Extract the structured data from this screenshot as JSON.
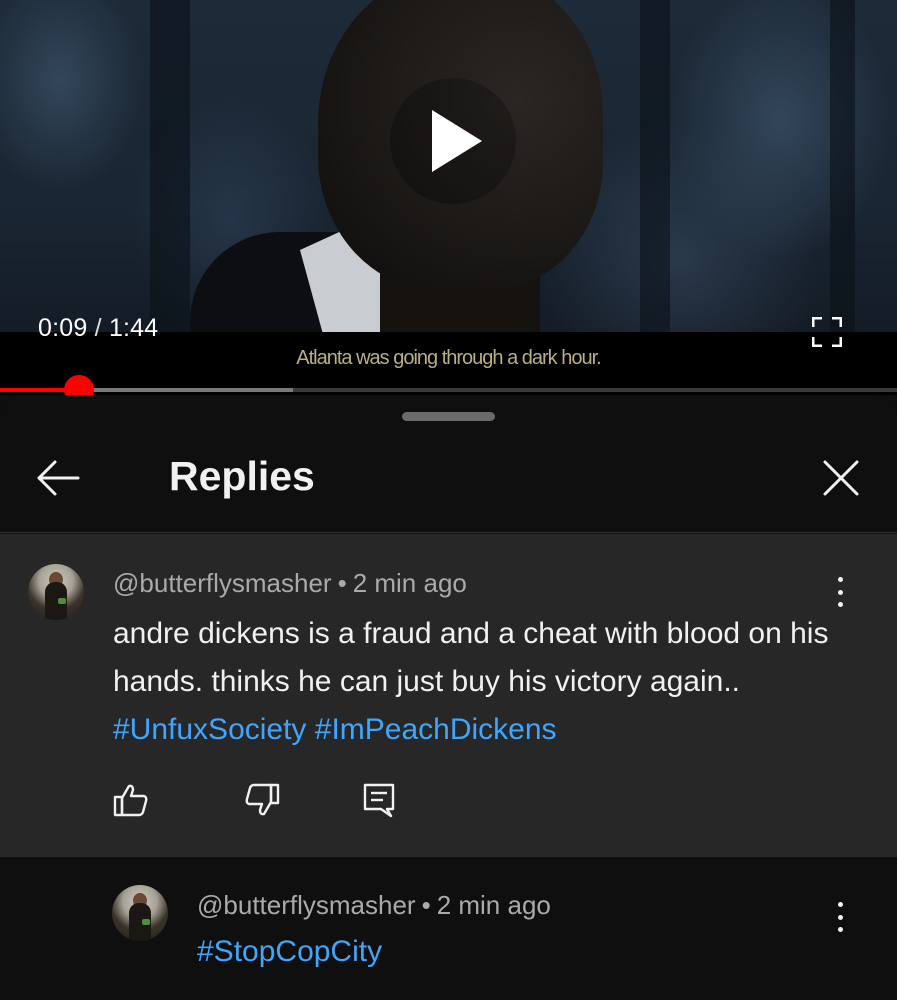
{
  "player": {
    "current_time": "0:09",
    "separator": "/",
    "duration": "1:44",
    "caption": "Atlanta was going through a dark hour.",
    "progress_fraction": 0.088,
    "buffered_fraction": 0.327
  },
  "sheet": {
    "title": "Replies"
  },
  "parent_comment": {
    "author": "@butterflysmasher",
    "dot": "•",
    "time": "2 min ago",
    "text_parts": [
      "andre dickens is a fraud and a cheat with blood on his hands. thinks he can just buy his victory again.. ",
      "#UnfuxSociety",
      " ",
      "#ImPeachDickens"
    ]
  },
  "reply_comment": {
    "author": "@butterflysmasher",
    "dot": "•",
    "time": "2 min ago",
    "text": "#StopCopCity"
  },
  "icons": {
    "play": "play-icon",
    "fullscreen": "fullscreen-icon",
    "back": "arrow-left-icon",
    "close": "close-icon",
    "more": "more-vert-icon",
    "like": "thumb-up-icon",
    "dislike": "thumb-down-icon",
    "reply": "comment-icon"
  },
  "colors": {
    "accent_red": "#ff0000",
    "hashtag_blue": "#3ea6ff",
    "caption_text": "#b9b07f"
  }
}
